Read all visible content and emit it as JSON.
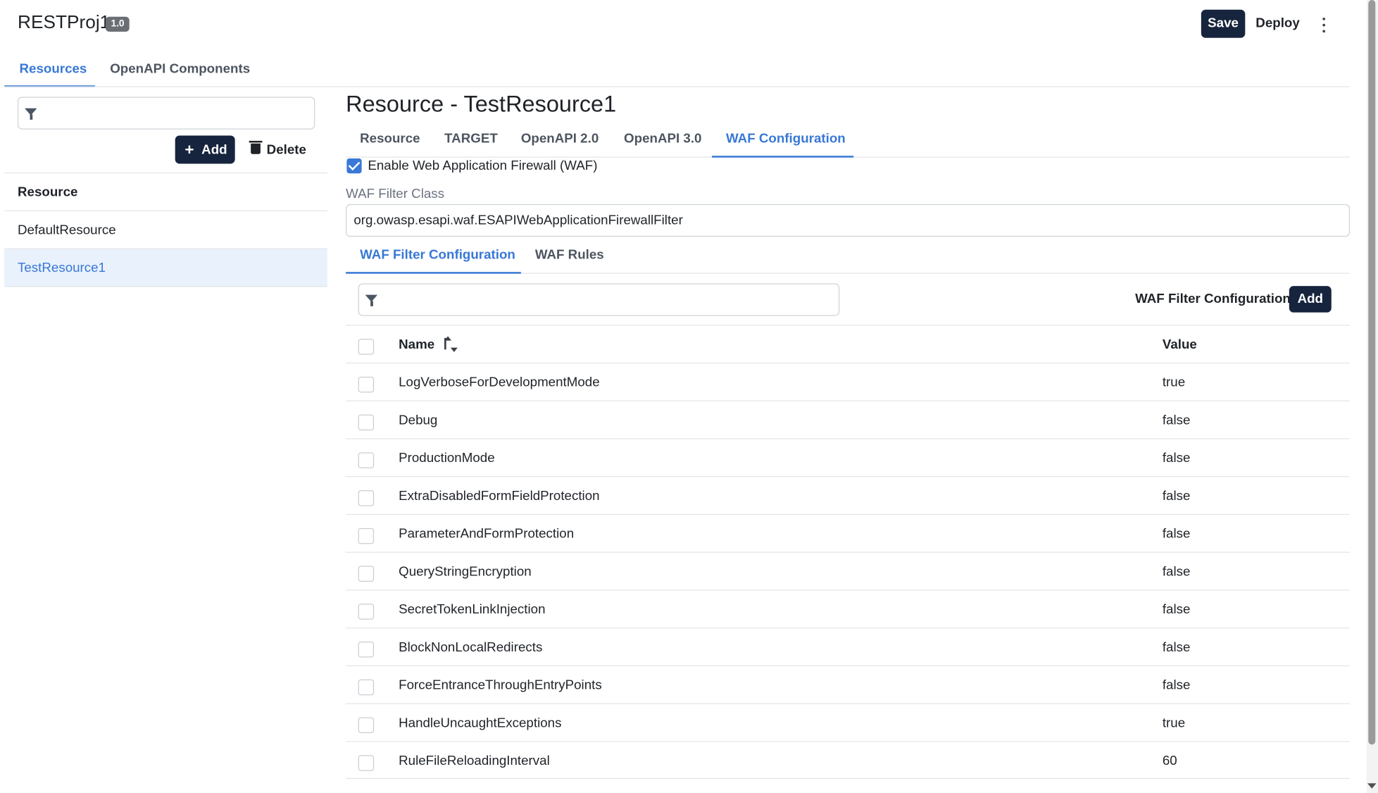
{
  "header": {
    "project_name": "RESTProj1",
    "version": "1.0",
    "save_label": "Save",
    "deploy_label": "Deploy"
  },
  "top_tabs": [
    {
      "label": "Resources",
      "active": true
    },
    {
      "label": "OpenAPI Components",
      "active": false
    }
  ],
  "left_panel": {
    "filter_value": "",
    "add_label": "Add",
    "delete_label": "Delete",
    "list_header": "Resource",
    "items": [
      {
        "label": "DefaultResource",
        "selected": false
      },
      {
        "label": "TestResource1",
        "selected": true
      }
    ]
  },
  "main": {
    "title": "Resource - TestResource1",
    "tabs": [
      {
        "label": "Resource",
        "active": false
      },
      {
        "label": "TARGET",
        "active": false
      },
      {
        "label": "OpenAPI 2.0",
        "active": false
      },
      {
        "label": "OpenAPI 3.0",
        "active": false
      },
      {
        "label": "WAF Configuration",
        "active": true
      }
    ],
    "waf_enabled": true,
    "waf_enabled_label": "Enable Web Application Firewall (WAF)",
    "filter_class_label": "WAF Filter Class",
    "filter_class_value": "org.owasp.esapi.waf.ESAPIWebApplicationFirewallFilter",
    "inner_tabs": [
      {
        "label": "WAF Filter Configuration",
        "active": true
      },
      {
        "label": "WAF Rules",
        "active": false
      }
    ],
    "config_filter_value": "",
    "config_label": "WAF Filter Configuration",
    "config_add_label": "Add",
    "table": {
      "columns": [
        "Name",
        "Value"
      ],
      "rows": [
        {
          "name": "LogVerboseForDevelopmentMode",
          "value": "true"
        },
        {
          "name": "Debug",
          "value": "false"
        },
        {
          "name": "ProductionMode",
          "value": "false"
        },
        {
          "name": "ExtraDisabledFormFieldProtection",
          "value": "false"
        },
        {
          "name": "ParameterAndFormProtection",
          "value": "false"
        },
        {
          "name": "QueryStringEncryption",
          "value": "false"
        },
        {
          "name": "SecretTokenLinkInjection",
          "value": "false"
        },
        {
          "name": "BlockNonLocalRedirects",
          "value": "false"
        },
        {
          "name": "ForceEntranceThroughEntryPoints",
          "value": "false"
        },
        {
          "name": "HandleUncaughtExceptions",
          "value": "true"
        },
        {
          "name": "RuleFileReloadingInterval",
          "value": "60"
        }
      ]
    }
  },
  "colors": {
    "accent": "#3878d6",
    "primary_button": "#16243d",
    "selected_row": "#e9f1fc"
  }
}
